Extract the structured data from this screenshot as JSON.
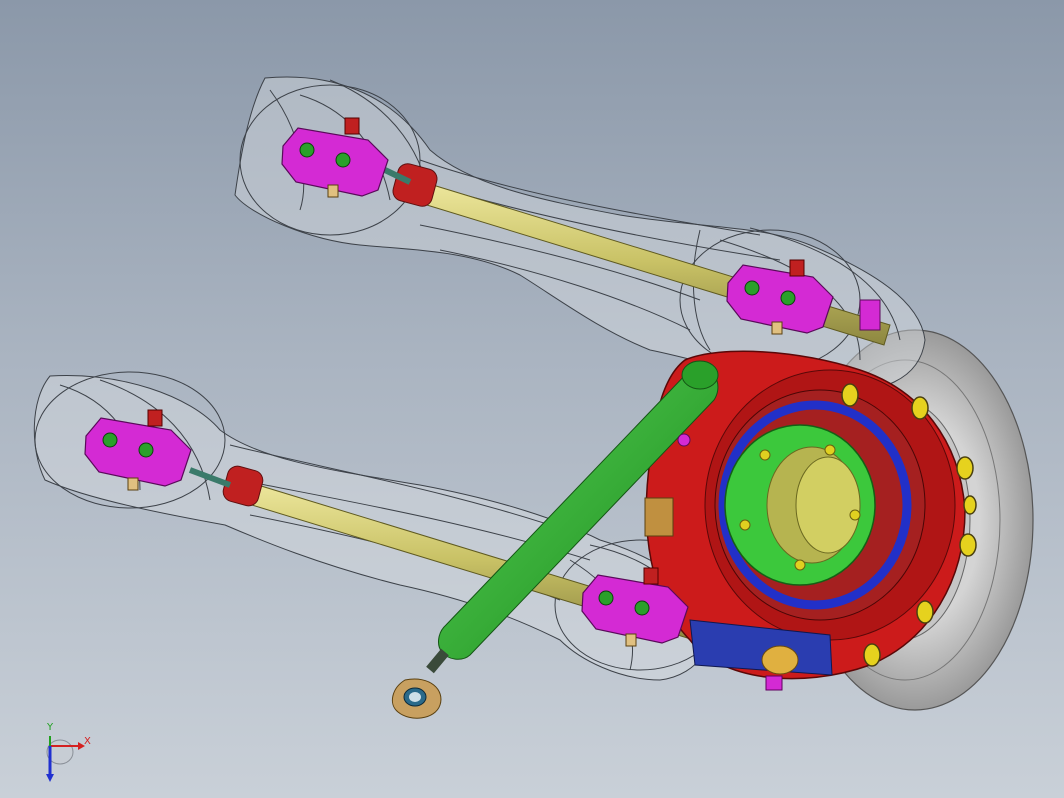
{
  "viewport": {
    "background_top": "#8b98a9",
    "background_bottom": "#c9d0d8"
  },
  "model": {
    "colors": {
      "arm_shell": "#d6dbe1",
      "arm_outline": "#4a4f56",
      "pushrod": "#c9c266",
      "tie_rod": "#28a428",
      "mount_bracket": "#d42ad4",
      "upright": "#d01b1b",
      "hub_green": "#3cc83c",
      "bearing_ring": "#2230c8",
      "brake_disc": "#bcbcbc",
      "bolts": "#e6d21e",
      "rod_end": "#c8a060"
    }
  },
  "triad": {
    "x_label": "X",
    "y_label": "Y",
    "x_color": "#d42020",
    "y_color": "#20a020",
    "z_color": "#2030d0"
  }
}
